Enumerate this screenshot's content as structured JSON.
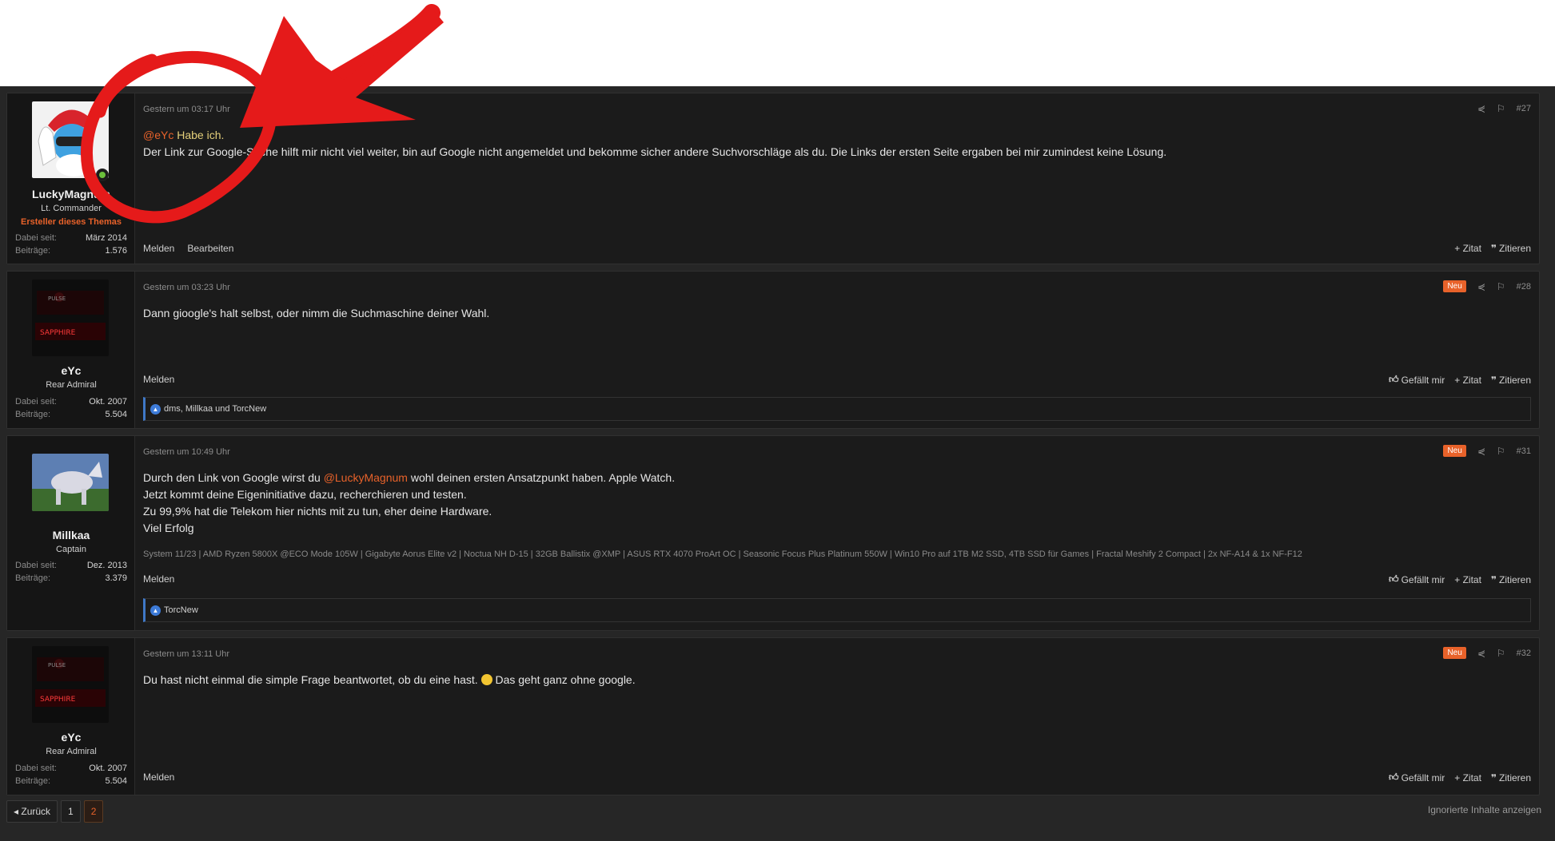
{
  "colors": {
    "accent": "#e8622a",
    "background": "#262626",
    "post_bg": "#1b1b1b",
    "reaction_bar": "#3f78c7",
    "annotation": "#e51a1a"
  },
  "posts": [
    {
      "avatar": "smurf-avatar",
      "username": "LuckyMagnum",
      "user_title": "Lt. Commander",
      "starter_label": "Ersteller dieses Themas",
      "joined_label": "Dabei seit:",
      "joined": "März 2014",
      "posts_label": "Beiträge:",
      "post_count": "1.576",
      "time": "Gestern um 03:17 Uhr",
      "number": "#27",
      "mention": "@eYc",
      "quote_text": " Habe ich.",
      "body": "Der Link zur Google-Suche hilft mir nicht viel weiter, bin auf Google nicht angemeldet und bekomme sicher andere Suchvorschläge als du. Die Links der ersten Seite ergaben bei mir zumindest keine Lösung.",
      "report": "Melden",
      "edit": "Bearbeiten",
      "quote_add": "+ Zitat",
      "reply": "Zitieren"
    },
    {
      "username": "eYc",
      "user_title": "Rear Admiral",
      "joined_label": "Dabei seit:",
      "joined": "Okt. 2007",
      "posts_label": "Beiträge:",
      "post_count": "5.504",
      "time": "Gestern um 03:23 Uhr",
      "new_badge": "Neu",
      "number": "#28",
      "body": "Dann gioogle's halt selbst, oder nimm die Suchmaschine deiner Wahl.",
      "report": "Melden",
      "like": "Gefällt mir",
      "quote_add": "+ Zitat",
      "reply": "Zitieren",
      "reactions": "dms, Millkaa und TorcNew"
    },
    {
      "username": "Millkaa",
      "user_title": "Captain",
      "joined_label": "Dabei seit:",
      "joined": "Dez. 2013",
      "posts_label": "Beiträge:",
      "post_count": "3.379",
      "time": "Gestern um 10:49 Uhr",
      "new_badge": "Neu",
      "number": "#31",
      "body_pre": "Durch den Link von Google wirst du ",
      "mention": "@LuckyMagnum",
      "body_post": " wohl deinen ersten Ansatzpunkt haben. Apple Watch.",
      "line2": "Jetzt kommt deine Eigeninitiative dazu, recherchieren und testen.",
      "line3": "Zu 99,9% hat die Telekom hier nichts mit zu tun, eher deine Hardware.",
      "line4": "Viel Erfolg",
      "signature": "System 11/23 | AMD Ryzen 5800X @ECO Mode 105W | Gigabyte Aorus Elite v2 | Noctua NH D-15 | 32GB Ballistix @XMP | ASUS RTX 4070 ProArt OC | Seasonic Focus Plus Platinum 550W | Win10 Pro auf 1TB M2 SSD, 4TB SSD für Games | Fractal Meshify 2 Compact | 2x NF-A14 & 1x NF-F12",
      "report": "Melden",
      "like": "Gefällt mir",
      "quote_add": "+ Zitat",
      "reply": "Zitieren",
      "reactions": "TorcNew"
    },
    {
      "username": "eYc",
      "user_title": "Rear Admiral",
      "joined_label": "Dabei seit:",
      "joined": "Okt. 2007",
      "posts_label": "Beiträge:",
      "post_count": "5.504",
      "time": "Gestern um 13:11 Uhr",
      "new_badge": "Neu",
      "number": "#32",
      "body_pre": "Du hast nicht einmal die simple Frage beantwortet, ob du eine hast. ",
      "body_post": " Das geht ganz ohne google.",
      "report": "Melden",
      "like": "Gefällt mir",
      "quote_add": "+ Zitat",
      "reply": "Zitieren"
    }
  ],
  "pagination": {
    "back": "Zurück",
    "page1": "1",
    "page2": "2"
  },
  "ignored_link": "Ignorierte Inhalte anzeigen"
}
